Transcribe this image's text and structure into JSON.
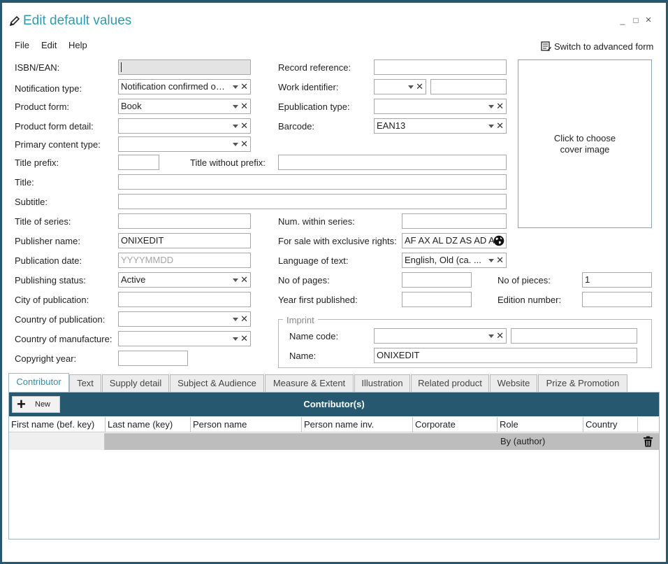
{
  "window": {
    "title": "Edit default values",
    "controls": [
      "_",
      "□",
      "×"
    ]
  },
  "menu": [
    "File",
    "Edit",
    "Help"
  ],
  "advanced_link": "Switch to advanced form",
  "cover": {
    "text_line1": "Click to choose",
    "text_line2": "cover image"
  },
  "fields": {
    "isbn": {
      "label": "ISBN/EAN:",
      "value": ""
    },
    "record_reference": {
      "label": "Record reference:",
      "value": ""
    },
    "notification_type": {
      "label": "Notification type:",
      "value": "Notification confirmed on..."
    },
    "work_identifier": {
      "label": "Work identifier:",
      "value": ""
    },
    "product_form": {
      "label": "Product form:",
      "value": "Book"
    },
    "epublication_type": {
      "label": "Epublication type:",
      "value": ""
    },
    "product_form_detail": {
      "label": "Product form detail:",
      "value": ""
    },
    "barcode": {
      "label": "Barcode:",
      "value": "EAN13"
    },
    "primary_content_type": {
      "label": "Primary content type:",
      "value": ""
    },
    "title_prefix": {
      "label": "Title prefix:",
      "value": ""
    },
    "title_without_prefix": {
      "label": "Title without prefix:",
      "value": ""
    },
    "title": {
      "label": "Title:",
      "value": ""
    },
    "subtitle": {
      "label": "Subtitle:",
      "value": ""
    },
    "title_of_series": {
      "label": "Title of series:",
      "value": ""
    },
    "num_within_series": {
      "label": "Num. within series:",
      "value": ""
    },
    "publisher_name": {
      "label": "Publisher name:",
      "value": "ONIXEDIT"
    },
    "for_sale_exclusive": {
      "label": "For sale with exclusive rights:",
      "value": "AF AX AL DZ AS AD A"
    },
    "publication_date": {
      "label": "Publication date:",
      "placeholder": "YYYYMMDD"
    },
    "language_of_text": {
      "label": "Language of text:",
      "value": "English, Old (ca. ..."
    },
    "publishing_status": {
      "label": "Publishing status:",
      "value": "Active"
    },
    "no_of_pages": {
      "label": "No of pages:",
      "value": ""
    },
    "no_of_pieces": {
      "label": "No of pieces:",
      "value": "1"
    },
    "city_of_publication": {
      "label": "City of publication:",
      "value": ""
    },
    "year_first_published": {
      "label": "Year first published:",
      "value": ""
    },
    "edition_number": {
      "label": "Edition number:",
      "value": ""
    },
    "country_of_publication": {
      "label": "Country of publication:",
      "value": ""
    },
    "country_of_manufacture": {
      "label": "Country of manufacture:",
      "value": ""
    },
    "copyright_year": {
      "label": "Copyright year:",
      "value": ""
    }
  },
  "imprint": {
    "legend": "Imprint",
    "name_code_label": "Name code:",
    "name_code_value": "",
    "name_code_extra": "",
    "name_label": "Name:",
    "name_value": "ONIXEDIT"
  },
  "tabs": [
    "Contributor",
    "Text",
    "Supply detail",
    "Subject & Audience",
    "Measure & Extent",
    "Illustration",
    "Related product",
    "Website",
    "Prize & Promotion"
  ],
  "active_tab": "Contributor",
  "contributors": {
    "title": "Contributor(s)",
    "new_button": "New",
    "columns": [
      "First name (bef. key)",
      "Last name (key)",
      "Person name",
      "Person name inv.",
      "Corporate",
      "Role",
      "Country"
    ],
    "rows": [
      {
        "first_name": "",
        "last_name": "",
        "person_name": "",
        "person_name_inv": "",
        "corporate": "",
        "role": "By (author)",
        "country": ""
      }
    ]
  },
  "colors": {
    "accent": "#2b9cb5",
    "frame": "#26586f",
    "header_bar": "#26586f",
    "selected_row": "#bdbdbd"
  }
}
